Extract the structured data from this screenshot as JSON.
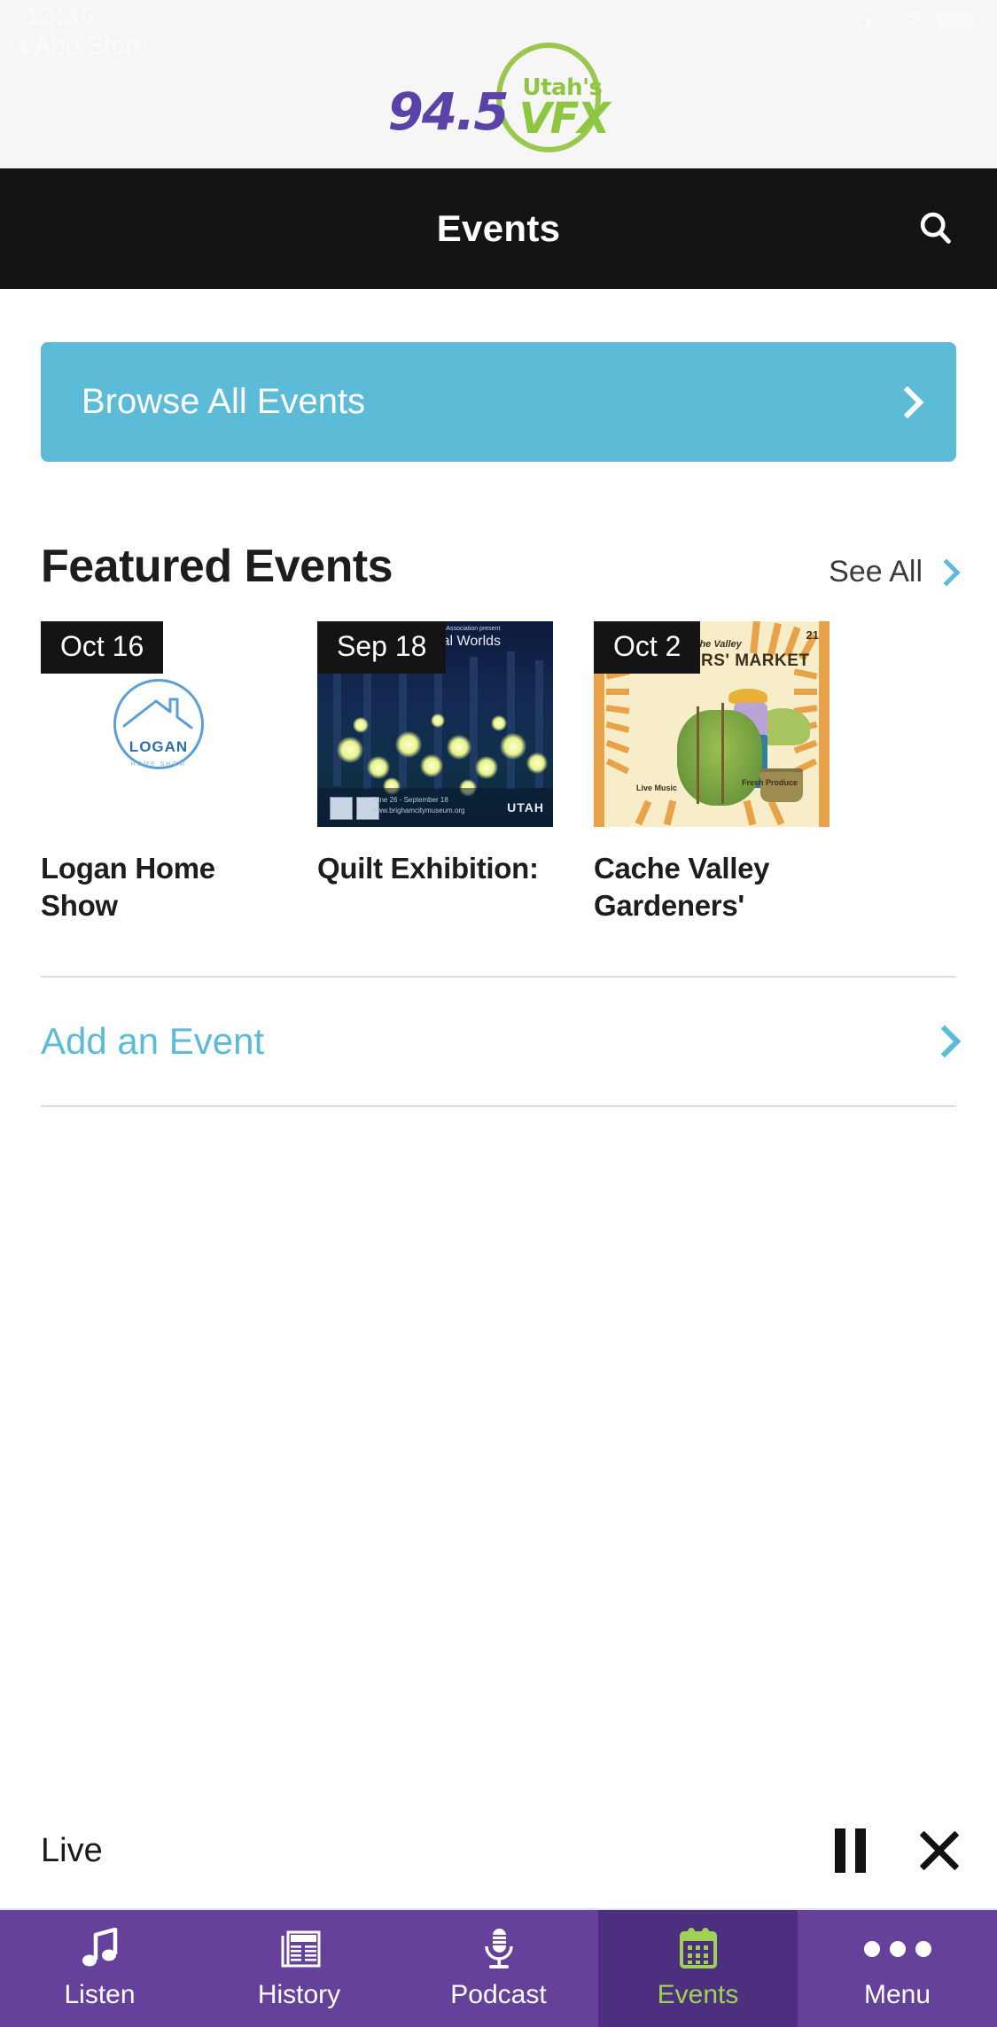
{
  "status_bar": {
    "time": "12:36",
    "back_label": "App Store",
    "icons": [
      "signal-bars-icon",
      "wifi-icon",
      "battery-icon"
    ]
  },
  "brand": {
    "frequency": "94.5",
    "tagline": "Utah's",
    "call_sign": "VFX",
    "purple": "#5b42a8",
    "green": "#8ec640"
  },
  "navbar": {
    "title": "Events",
    "search_icon": "search-icon"
  },
  "browse": {
    "label": "Browse All Events",
    "chevron": "chevron-right-icon",
    "background": "#5cbcd7"
  },
  "featured": {
    "title": "Featured Events",
    "see_all_label": "See All",
    "see_all_chevron": "chevron-right-icon",
    "cards": [
      {
        "date": "Oct 16",
        "title": "Logan Home Show",
        "artwork": {
          "kind": "logan-home-show-logo",
          "mark_text": "LOGAN",
          "mark_sub": "HOME SHOW"
        }
      },
      {
        "date": "Sep 18",
        "title": "Quilt Exhibition:",
        "artwork": {
          "kind": "quilt-natural-worlds-poster",
          "presenter": "Utah Art Quilt Association present",
          "headline": "Natural Worlds",
          "dates": "June 26 - September 18",
          "website": "www.brighamcitymuseum.org",
          "sponsor": "UTAH"
        }
      },
      {
        "date": "Oct 2",
        "title": "Cache Valley Gardeners'",
        "artwork": {
          "kind": "gardeners-market-poster",
          "line1": "Cache Valley",
          "line2": "GARDENERS' MARKET",
          "year": "21",
          "note_left": "Live Music",
          "note_right": "Fresh Produce"
        }
      }
    ]
  },
  "add_event": {
    "label": "Add an Event",
    "chevron": "chevron-right-icon"
  },
  "player": {
    "label": "Live",
    "pause_icon": "pause-icon",
    "close_icon": "close-icon"
  },
  "tabbar": {
    "active_color": "#9fd154",
    "items": [
      {
        "label": "Listen",
        "icon": "music-note-icon",
        "active": false
      },
      {
        "label": "History",
        "icon": "newspaper-icon",
        "active": false
      },
      {
        "label": "Podcast",
        "icon": "microphone-icon",
        "active": false
      },
      {
        "label": "Events",
        "icon": "calendar-icon",
        "active": true
      },
      {
        "label": "Menu",
        "icon": "ellipsis-icon",
        "active": false
      }
    ]
  }
}
